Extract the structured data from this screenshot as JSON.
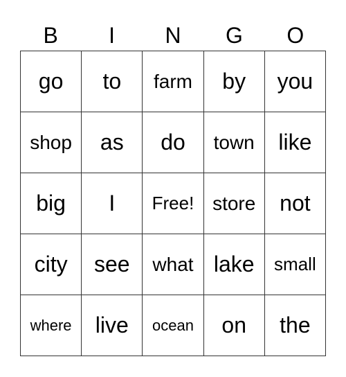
{
  "header": [
    "B",
    "I",
    "N",
    "G",
    "O"
  ],
  "rows": [
    [
      "go",
      "to",
      "farm",
      "by",
      "you"
    ],
    [
      "shop",
      "as",
      "do",
      "town",
      "like"
    ],
    [
      "big",
      "I",
      "Free!",
      "store",
      "not"
    ],
    [
      "city",
      "see",
      "what",
      "lake",
      "small"
    ],
    [
      "where",
      "live",
      "ocean",
      "on",
      "the"
    ]
  ]
}
